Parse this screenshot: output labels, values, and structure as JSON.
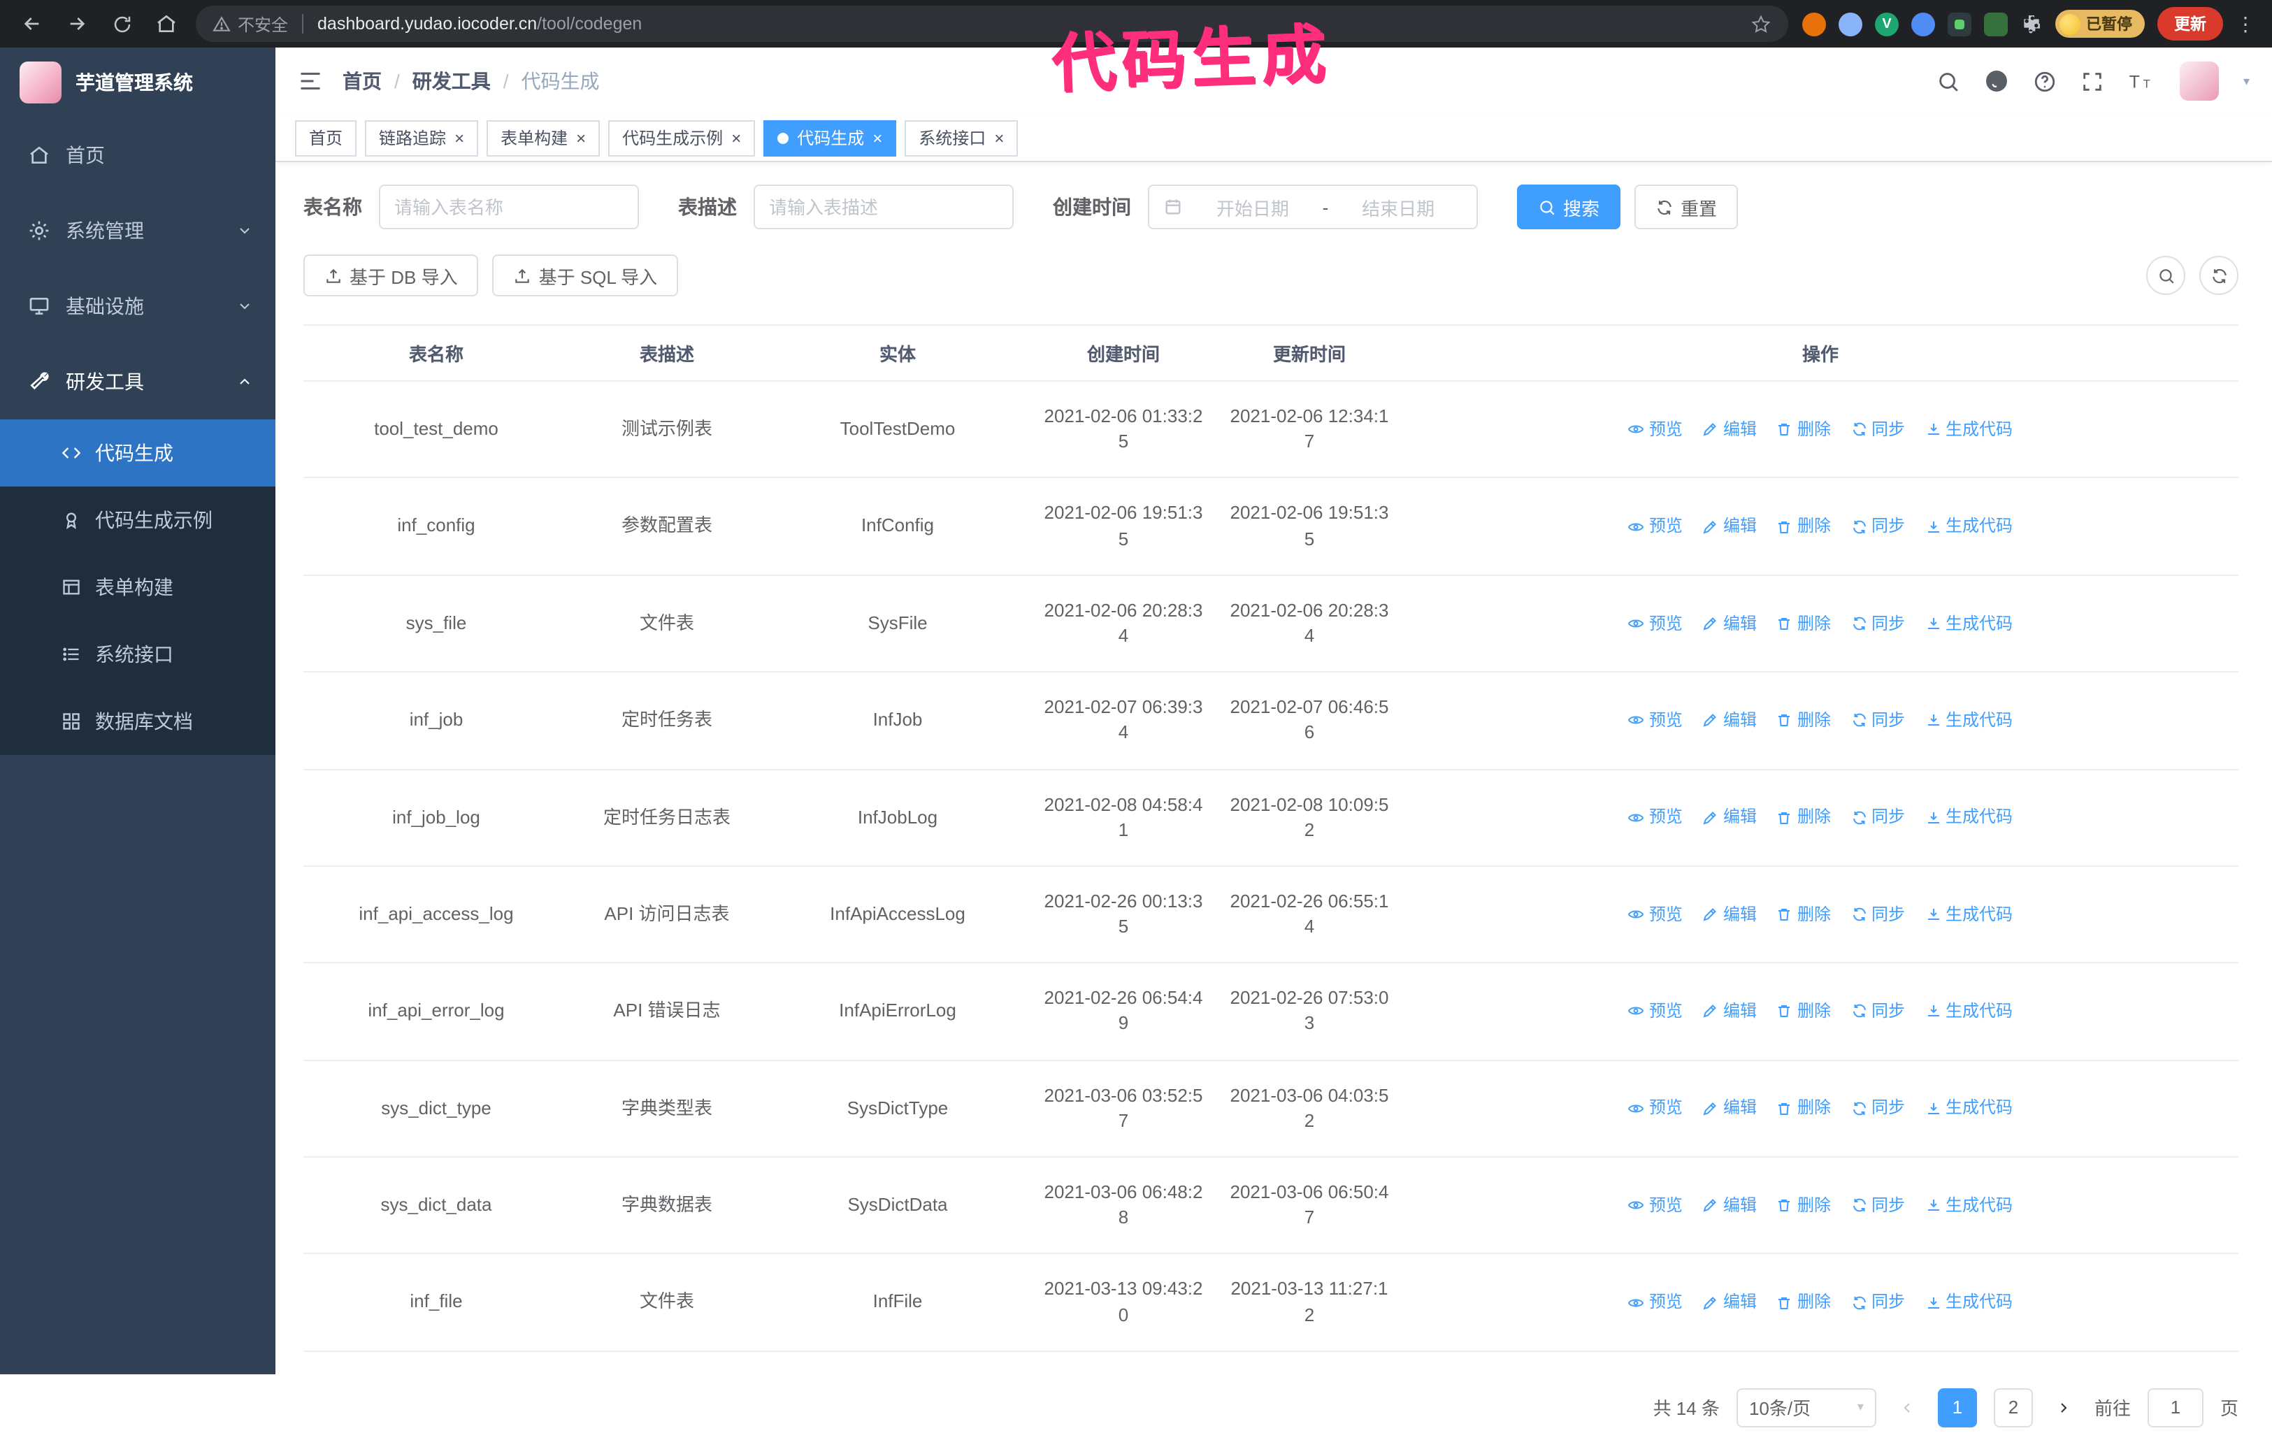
{
  "colors": {
    "accent": "#409eff",
    "sidebar_bg": "#304156",
    "submenu_bg": "#1f2d3d",
    "active_item_bg": "#2d74c4",
    "annotation": "#ff2e7c",
    "update_chip": "#d93a2b",
    "paused_chip": "#e7ba62"
  },
  "icons": {
    "browser": [
      "back-icon",
      "forward-icon",
      "reload-icon",
      "home-icon",
      "warning-icon",
      "bookmark-star-icon",
      "extensions-puzzle-icon",
      "menu-kebab-icon"
    ],
    "header": [
      "hamburger-icon",
      "search-icon",
      "github-icon",
      "help-icon",
      "fullscreen-icon",
      "font-size-icon",
      "caret-down-icon"
    ],
    "sidebar": [
      "home-icon",
      "gear-icon",
      "monitor-icon",
      "wrench-icon",
      "code-icon",
      "award-icon",
      "form-grid-icon",
      "api-list-icon",
      "db-grid-icon",
      "chevron-down-icon",
      "chevron-up-icon"
    ],
    "filters": [
      "calendar-icon",
      "search-icon",
      "refresh-icon"
    ],
    "toolbar": [
      "upload-icon",
      "search-icon",
      "refresh-icon"
    ],
    "row_actions": [
      "eye-icon",
      "edit-icon",
      "delete-icon",
      "sync-icon",
      "download-icon"
    ]
  },
  "browser": {
    "security_label": "不安全",
    "url_host": "dashboard.yudao.iocoder.cn",
    "url_path": "/tool/codegen",
    "paused_label": "已暂停",
    "update_label": "更新"
  },
  "annotation": {
    "text": "代码生成",
    "color": "#ff2e7c"
  },
  "sidebar": {
    "logo_title": "芋道管理系统",
    "items": [
      {
        "label": "首页"
      },
      {
        "label": "系统管理"
      },
      {
        "label": "基础设施"
      },
      {
        "label": "研发工具"
      }
    ],
    "submenu": [
      {
        "label": "代码生成",
        "active": true
      },
      {
        "label": "代码生成示例"
      },
      {
        "label": "表单构建"
      },
      {
        "label": "系统接口"
      },
      {
        "label": "数据库文档"
      }
    ]
  },
  "header": {
    "breadcrumb": [
      "首页",
      "研发工具",
      "代码生成"
    ]
  },
  "tabs": [
    {
      "label": "首页"
    },
    {
      "label": "链路追踪"
    },
    {
      "label": "表单构建"
    },
    {
      "label": "代码生成示例"
    },
    {
      "label": "代码生成",
      "active": true
    },
    {
      "label": "系统接口"
    }
  ],
  "filters": {
    "table_name_label": "表名称",
    "table_name_placeholder": "请输入表名称",
    "table_desc_label": "表描述",
    "table_desc_placeholder": "请输入表描述",
    "create_time_label": "创建时间",
    "start_placeholder": "开始日期",
    "range_separator": "-",
    "end_placeholder": "结束日期",
    "search_label": "搜索",
    "reset_label": "重置"
  },
  "toolbar": {
    "import_db_label": "基于 DB 导入",
    "import_sql_label": "基于 SQL 导入"
  },
  "table": {
    "headers": [
      "表名称",
      "表描述",
      "实体",
      "创建时间",
      "更新时间",
      "操作"
    ],
    "actions": [
      {
        "label": "预览"
      },
      {
        "label": "编辑"
      },
      {
        "label": "删除"
      },
      {
        "label": "同步"
      },
      {
        "label": "生成代码"
      }
    ],
    "rows": [
      {
        "name": "tool_test_demo",
        "desc": "测试示例表",
        "entity": "ToolTestDemo",
        "created": "2021-02-06 01:33:25",
        "updated": "2021-02-06 12:34:17"
      },
      {
        "name": "inf_config",
        "desc": "参数配置表",
        "entity": "InfConfig",
        "created": "2021-02-06 19:51:35",
        "updated": "2021-02-06 19:51:35"
      },
      {
        "name": "sys_file",
        "desc": "文件表",
        "entity": "SysFile",
        "created": "2021-02-06 20:28:34",
        "updated": "2021-02-06 20:28:34"
      },
      {
        "name": "inf_job",
        "desc": "定时任务表",
        "entity": "InfJob",
        "created": "2021-02-07 06:39:34",
        "updated": "2021-02-07 06:46:56"
      },
      {
        "name": "inf_job_log",
        "desc": "定时任务日志表",
        "entity": "InfJobLog",
        "created": "2021-02-08 04:58:41",
        "updated": "2021-02-08 10:09:52"
      },
      {
        "name": "inf_api_access_log",
        "desc": "API 访问日志表",
        "entity": "InfApiAccessLog",
        "created": "2021-02-26 00:13:35",
        "updated": "2021-02-26 06:55:14"
      },
      {
        "name": "inf_api_error_log",
        "desc": "API 错误日志",
        "entity": "InfApiErrorLog",
        "created": "2021-02-26 06:54:49",
        "updated": "2021-02-26 07:53:03"
      },
      {
        "name": "sys_dict_type",
        "desc": "字典类型表",
        "entity": "SysDictType",
        "created": "2021-03-06 03:52:57",
        "updated": "2021-03-06 04:03:52"
      },
      {
        "name": "sys_dict_data",
        "desc": "字典数据表",
        "entity": "SysDictData",
        "created": "2021-03-06 06:48:28",
        "updated": "2021-03-06 06:50:47"
      },
      {
        "name": "inf_file",
        "desc": "文件表",
        "entity": "InfFile",
        "created": "2021-03-13 09:43:20",
        "updated": "2021-03-13 11:27:12"
      }
    ]
  },
  "pagination": {
    "total_label": "共 14 条",
    "page_size_label": "10条/页",
    "pages": [
      "1",
      "2"
    ],
    "active_page": "1",
    "goto_label": "前往",
    "goto_value": "1",
    "goto_suffix_label": "页"
  }
}
